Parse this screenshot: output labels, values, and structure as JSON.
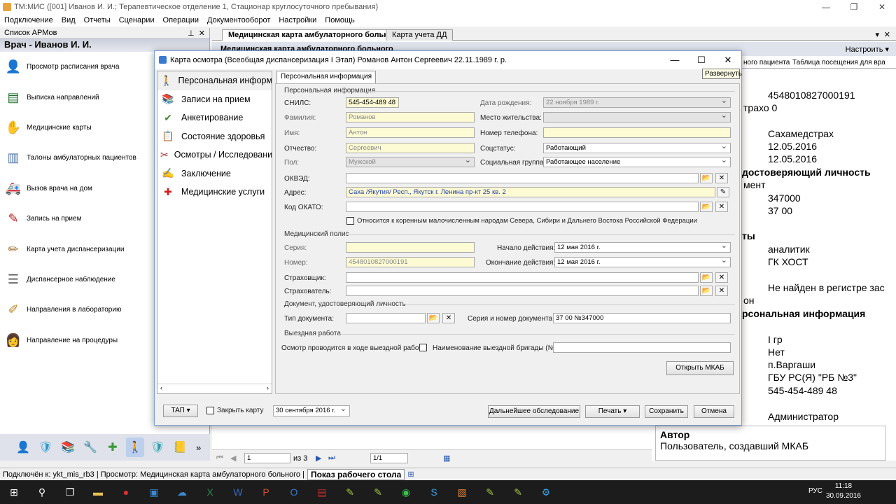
{
  "window": {
    "title": "ТМ:МИС ([001] Иванов И. И.; Терапевтическое отделение 1, Стационар круглосуточного пребывания)",
    "btn_min": "—",
    "btn_max": "❐",
    "btn_close": "✕"
  },
  "menu": [
    "Подключение",
    "Вид",
    "Отчеты",
    "Сценарии",
    "Операции",
    "Документооборот",
    "Настройки",
    "Помощь"
  ],
  "left": {
    "header": "Список АРМов",
    "pin": "⊥",
    "close": "✕",
    "title": "Врач - Иванов И. И.",
    "items": [
      {
        "label": "Просмотр расписания врача",
        "icon": "👤",
        "color": "#2a63b8"
      },
      {
        "label": "Выписка направлений",
        "icon": "▤",
        "color": "#1f6e2c"
      },
      {
        "label": "Медицинские карты",
        "icon": "✋",
        "color": "#b07a4a"
      },
      {
        "label": "Талоны амбулаторных пациентов",
        "icon": "▥",
        "color": "#5a7db0"
      },
      {
        "label": "Вызов врача на дом",
        "icon": "🚑",
        "color": "#c03030"
      },
      {
        "label": "Запись на прием",
        "icon": "✎",
        "color": "#b02020"
      },
      {
        "label": "Карта учета диспансеризации",
        "icon": "✏",
        "color": "#a07030"
      },
      {
        "label": "Диспансерное наблюдение",
        "icon": "☰",
        "color": "#555"
      },
      {
        "label": "Направления в лабораторию",
        "icon": "✐",
        "color": "#c08020"
      },
      {
        "label": "Направление на процедуры",
        "icon": "👩",
        "color": "#8a2030"
      }
    ],
    "bottom_icons": [
      {
        "icon": "👤",
        "color": "#3a6fc0"
      },
      {
        "icon": "🛡",
        "color": "#2a9ad0"
      },
      {
        "icon": "📚",
        "color": "#888"
      },
      {
        "icon": "🔧",
        "color": "#777"
      },
      {
        "icon": "✚",
        "color": "#3a9a3a"
      },
      {
        "icon": "🚶",
        "color": "#3a6fc0"
      },
      {
        "icon": "🛡",
        "color": "#2aa0b0"
      },
      {
        "icon": "📒",
        "color": "#8a6a30"
      }
    ],
    "more": "»"
  },
  "tabs": [
    {
      "label": "Медицинская карта амбулаторного больного",
      "active": true
    },
    {
      "label": "Карта учета ДД",
      "active": false
    }
  ],
  "tab_close": "✕",
  "tab_arrow": "▾",
  "strip_text": "Медицинская карта амбулаторного больного",
  "settings": "Настроить ▾",
  "right_tabs": "Таблица посещения для вра",
  "right_tab_left": "ного пациента",
  "right_values": [
    "4548010827000191",
    "трахо 0",
    "Сахамедстрах",
    "12.05.2016",
    "12.05.2016",
    "достоверяющий личность",
    "мент",
    "347000",
    "37 00",
    "ты",
    "аналитик",
    "ГК ХОСТ",
    "Не найден в регистре зас",
    "он",
    "рсональная информация",
    "I гр",
    "Нет",
    "п.Варгаши",
    "ГБУ РС(Я) \"РБ №3\"",
    "545-454-489 48",
    "Администратор"
  ],
  "tooltip": "Развернуть",
  "dialog": {
    "title": "Карта осмотра (Всеобщая диспансеризация I Этап) Романов Антон Сергеевич 22.11.1989 г. р.",
    "nav": [
      {
        "label": "Персональная информация",
        "icon": "🚶",
        "color": "#d09020"
      },
      {
        "label": "Записи на прием",
        "icon": "📚",
        "color": "#3070c0"
      },
      {
        "label": "Анкетирование",
        "icon": "✔",
        "color": "#4a8a30"
      },
      {
        "label": "Состояние здоровья",
        "icon": "📋",
        "color": "#c08020"
      },
      {
        "label": "Осмотры / Исследования",
        "icon": "✂",
        "color": "#a03030"
      },
      {
        "label": "Заключение",
        "icon": "✍",
        "color": "#666"
      },
      {
        "label": "Медицинские услуги",
        "icon": "✚",
        "color": "#d02020"
      }
    ],
    "subtab": "Персональная информация",
    "sec_personal": "Персональная информация",
    "snils_label": "СНИЛС:",
    "snils": "545-454-489 48",
    "birth_label": "Дата рождения:",
    "birth": "22  ноября  1989 г.",
    "fam_label": "Фамилия:",
    "fam": "Романов",
    "place_label": "Место жительства:",
    "place": "",
    "name_label": "Имя:",
    "name": "Антон",
    "phone_label": "Номер телефона:",
    "phone": "",
    "otch_label": "Отчество:",
    "otch": "Сергеевич",
    "soc_label": "Соцстатус:",
    "soc": "Работающий",
    "pol_label": "Пол:",
    "pol": "Мужской",
    "socgr_label": "Социальная группа:",
    "socgr": "Работающее население",
    "okved_label": "ОКВЭД:",
    "okved": "",
    "addr_label": "Адрес:",
    "addr": "Саха /Якутия/ Респ., Якутск г. Ленина пр-кт 25 кв. 2",
    "okato_label": "Код ОКАТО:",
    "okato": "",
    "native_label": "Относится к коренным малочисленным народам Севера, Сибири и Дальнего Востока Российской Федерации",
    "sec_polis": "Медицинский полис",
    "seria_label": "Серия:",
    "seria": "",
    "start_label": "Начало действия:",
    "start": "12    мая     2016 г.",
    "num_label": "Номер:",
    "num": "4548010827000191",
    "end_label": "Окончание действия:",
    "end": "12    мая     2016 г.",
    "insurer_label": "Страховщик:",
    "insurer": "",
    "insured_label": "Страхователь:",
    "insured": "",
    "sec_doc": "Документ, удостоверяющий личность",
    "doctype_label": "Тип документа:",
    "doctype": "",
    "docnum_label": "Серия и номер документа:",
    "docnum": "37 00 №347000",
    "sec_out": "Выездная работа",
    "out_label": "Осмотр проводится в ходе выездной работы",
    "brig_label": "Наименование выездной бригады (№):",
    "brig": "",
    "open_mkab": "Открыть МКАБ",
    "tap": "ТАП ▾",
    "close_card": "Закрыть карту",
    "date": "30 сентября 2016 г.",
    "further": "Дальнейшее обследование",
    "print": "Печать",
    "save": "Сохранить",
    "cancel": "Отмена"
  },
  "nav": {
    "page": "1",
    "of": "из 3",
    "page2": "1/1"
  },
  "autor_title": "Автор",
  "autor_desc": "Пользователь, создавший МКАБ",
  "status": "Подключён к: ykt_mis_rb3  |  Просмотр: Медицинская карта амбулаторного больного  |",
  "desktop_btn": "Показ рабочего стола",
  "tray_lang": "РУС",
  "time": "11:18",
  "tray_date": "30.09.2016"
}
